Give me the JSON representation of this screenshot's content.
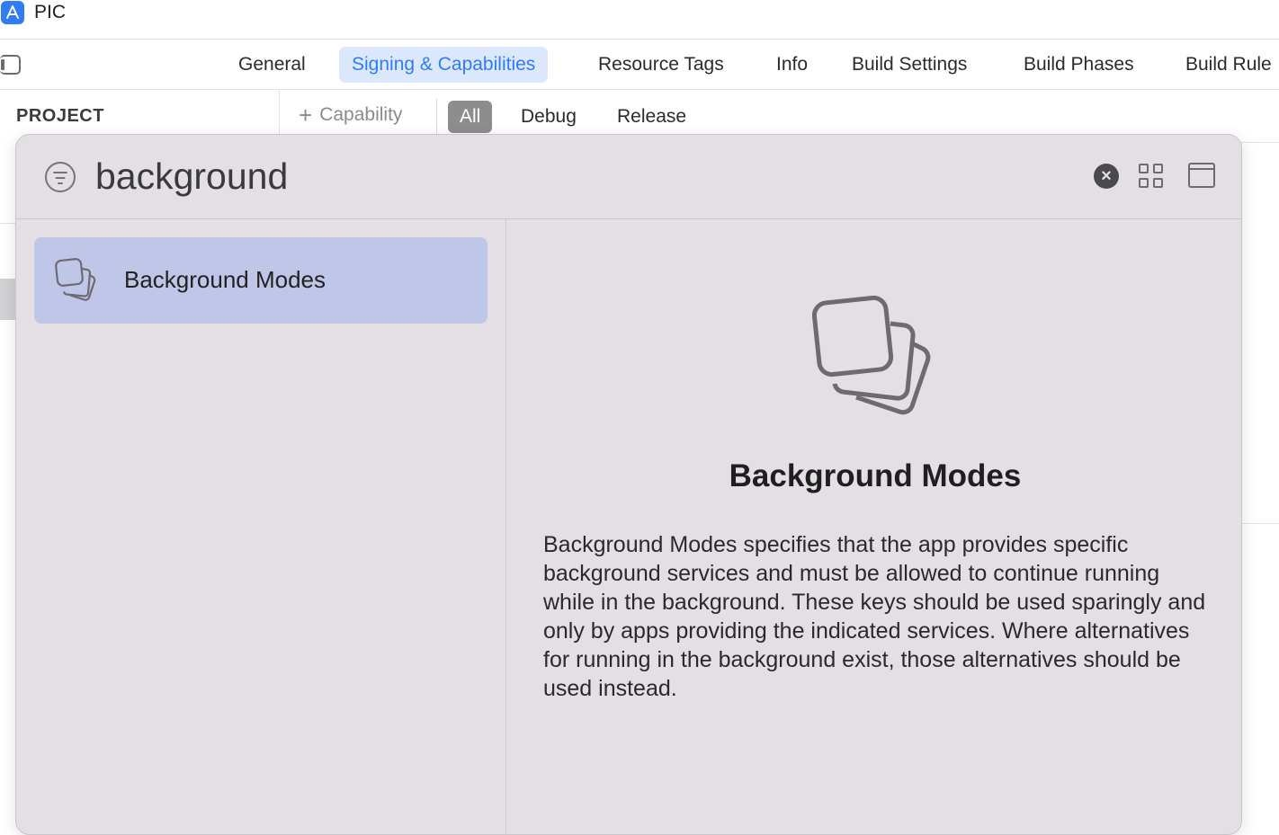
{
  "window": {
    "title": "PIC",
    "app_icon": "app-store-icon"
  },
  "tabs": [
    {
      "label": "General",
      "active": false
    },
    {
      "label": "Signing & Capabilities",
      "active": true
    },
    {
      "label": "Resource Tags",
      "active": false
    },
    {
      "label": "Info",
      "active": false
    },
    {
      "label": "Build Settings",
      "active": false
    },
    {
      "label": "Build Phases",
      "active": false
    },
    {
      "label": "Build Rule",
      "active": false
    }
  ],
  "sidebar": {
    "section_label": "PROJECT"
  },
  "toolbar": {
    "add_capability_label": "Capability",
    "filters": [
      {
        "label": "All",
        "active": true
      },
      {
        "label": "Debug",
        "active": false
      },
      {
        "label": "Release",
        "active": false
      }
    ]
  },
  "library": {
    "search": {
      "value": "background",
      "placeholder": ""
    },
    "results": [
      {
        "label": "Background Modes",
        "icon": "stacked-squares-icon",
        "selected": true
      }
    ],
    "detail": {
      "icon": "stacked-squares-icon",
      "title": "Background Modes",
      "description": "Background Modes specifies that the app provides specific background services and must be allowed to continue running while in the background. These keys should be used sparingly and only by apps providing the indicated services. Where alternatives for running in the background exist, those alternatives should be used instead."
    }
  },
  "colors": {
    "accent": "#2f7cf6",
    "active_tab_bg": "#dbe8fc",
    "selected_row_bg": "#bfc6e8",
    "panel_bg": "#e3dfe5",
    "segment_active_bg": "#8d8d8f"
  }
}
